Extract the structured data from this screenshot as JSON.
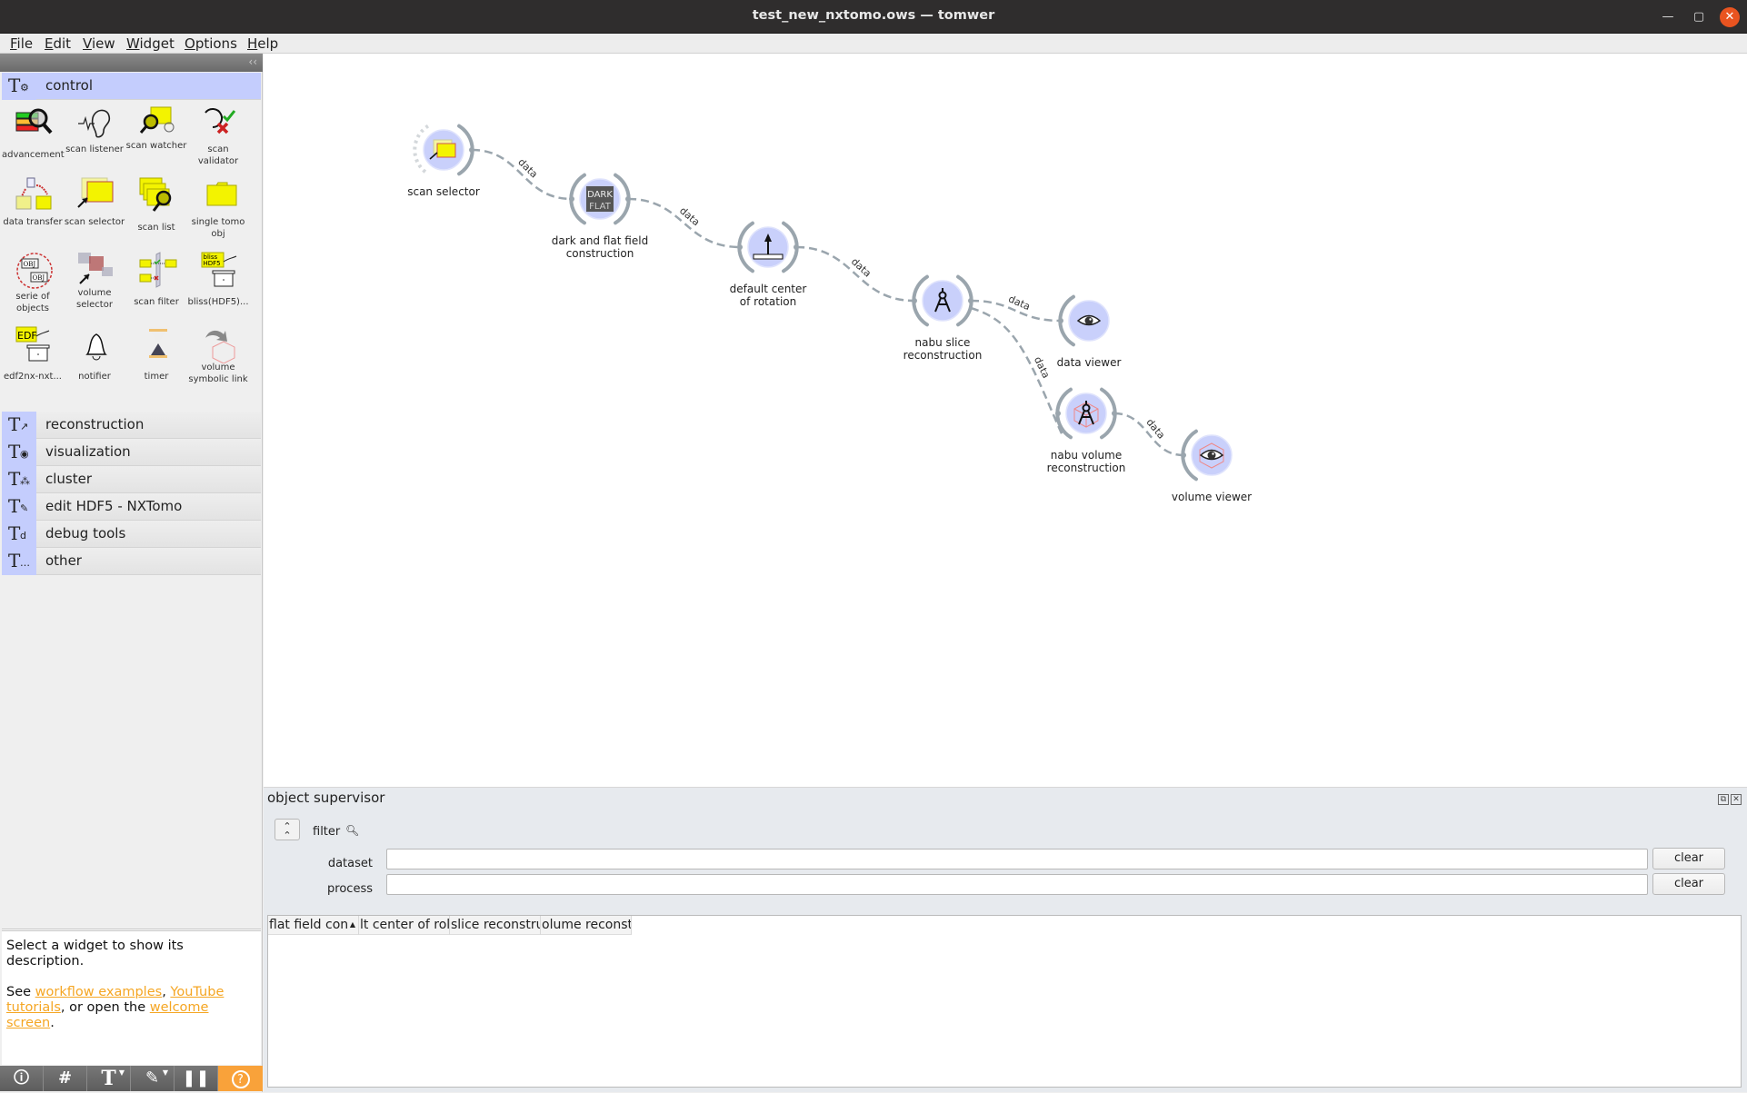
{
  "window": {
    "title": "test_new_nxtomo.ows — tomwer",
    "controls": {
      "minimize": "—",
      "maximize": "▢",
      "close": "✕"
    }
  },
  "menu": [
    "File",
    "Edit",
    "View",
    "Widget",
    "Options",
    "Help"
  ],
  "palette": {
    "collapse_glyph": "‹‹",
    "active_category": {
      "label": "control",
      "icon": "tomwer-control-gears-icon",
      "widgets": [
        {
          "label": "advancement",
          "icon": "progress-bars-magnifier-icon"
        },
        {
          "label": "scan listener",
          "icon": "ear-signal-icon"
        },
        {
          "label": "scan watcher",
          "icon": "folder-magnifier-clock-icon"
        },
        {
          "label": "scan validator",
          "icon": "check-cross-icon"
        },
        {
          "label": "data transfer",
          "icon": "folder-transfer-icon"
        },
        {
          "label": "scan selector",
          "icon": "folder-pointer-icon"
        },
        {
          "label": "scan list",
          "icon": "folders-magnifier-icon"
        },
        {
          "label": "single tomo obj",
          "icon": "yellow-folder-icon"
        },
        {
          "label": "serie of objects",
          "icon": "obj-series-icon"
        },
        {
          "label": "volume selector",
          "icon": "volume-cubes-pointer-icon"
        },
        {
          "label": "scan filter",
          "icon": "folders-filter-icon"
        },
        {
          "label": "bliss(HDF5)...",
          "icon": "bliss-hdf5-converter-icon"
        },
        {
          "label": "edf2nx-nxt...",
          "icon": "edf-converter-icon"
        },
        {
          "label": "notifier",
          "icon": "bell-icon"
        },
        {
          "label": "timer",
          "icon": "hourglass-icon"
        },
        {
          "label": "volume symbolic link",
          "icon": "cube-link-arrow-icon"
        }
      ]
    },
    "categories": [
      {
        "label": "reconstruction",
        "icon_sub": "↗",
        "icon": "tomwer-hammer-icon"
      },
      {
        "label": "visualization",
        "icon_sub": "◉",
        "icon": "tomwer-eye-icon"
      },
      {
        "label": "cluster",
        "icon_sub": "⁂",
        "icon": "tomwer-cluster-icon"
      },
      {
        "label": "edit HDF5 - NXTomo",
        "icon_sub": "✎",
        "icon": "tomwer-pencil-icon"
      },
      {
        "label": "debug tools",
        "icon_sub": "d",
        "icon": "tomwer-debug-icon"
      },
      {
        "label": "other",
        "icon_sub": "…",
        "icon": "tomwer-other-icon"
      }
    ],
    "description": {
      "line1": "Select a widget to show its description.",
      "see": "See ",
      "link1": "workflow examples",
      "comma": ", ",
      "link2": "YouTube tutorials",
      "or_open": ", or open the ",
      "link3": "welcome screen",
      "period": "."
    },
    "toolbar": [
      {
        "name": "info-button",
        "glyph": "🛈",
        "dropdown": false
      },
      {
        "name": "grid-button",
        "glyph": "#",
        "dropdown": false
      },
      {
        "name": "text-annotation-button",
        "glyph": "T",
        "dropdown": true
      },
      {
        "name": "arrow-annotation-button",
        "glyph": "✎",
        "dropdown": true
      },
      {
        "name": "pause-button",
        "glyph": "❚❚",
        "dropdown": false
      },
      {
        "name": "help-button",
        "glyph": "?",
        "dropdown": false
      }
    ]
  },
  "workflow": {
    "nodes": [
      {
        "id": "scan-selector",
        "label": "scan selector",
        "icon": "folder-pointer-icon",
        "has_input": false
      },
      {
        "id": "dark-flat",
        "label": "dark and flat field construction",
        "icon": "dark-flat-icon",
        "icon_text_top": "DARK",
        "icon_text_bottom": "FLAT",
        "has_input": true
      },
      {
        "id": "default-cor",
        "label": "default center of rotation",
        "icon": "arrow-ruler-icon",
        "has_input": true
      },
      {
        "id": "nabu-slice",
        "label": "nabu slice reconstruction",
        "icon": "compass-icon",
        "has_input": true
      },
      {
        "id": "data-viewer",
        "label": "data viewer",
        "icon": "eye-icon",
        "has_input": true,
        "has_output": false
      },
      {
        "id": "nabu-volume",
        "label": "nabu volume reconstruction",
        "icon": "compass-cube-icon",
        "has_input": true
      },
      {
        "id": "volume-viewer",
        "label": "volume viewer",
        "icon": "eye-cube-icon",
        "has_input": true,
        "has_output": false
      }
    ],
    "links": [
      {
        "from": "scan-selector",
        "to": "dark-flat",
        "label": "data"
      },
      {
        "from": "dark-flat",
        "to": "default-cor",
        "label": "data"
      },
      {
        "from": "default-cor",
        "to": "nabu-slice",
        "label": "data"
      },
      {
        "from": "nabu-slice",
        "to": "data-viewer",
        "label": "data"
      },
      {
        "from": "nabu-slice",
        "to": "nabu-volume",
        "label": "data"
      },
      {
        "from": "nabu-volume",
        "to": "volume-viewer",
        "label": "data"
      }
    ]
  },
  "object_supervisor": {
    "title": "object supervisor",
    "float_glyph": "⧉",
    "close_glyph": "✕",
    "collapse_glyph": "⌃⌃",
    "filter_label": "filter",
    "filter_icon": "search-icon",
    "fields": [
      {
        "label": "dataset",
        "value": "",
        "clear_label": "clear"
      },
      {
        "label": "process",
        "value": "",
        "clear_label": "clear"
      }
    ],
    "columns": [
      "flat field con",
      "lt center of rol",
      "slice reconstru",
      "olume reconst"
    ],
    "sort_indicator": "▲",
    "rows": []
  }
}
